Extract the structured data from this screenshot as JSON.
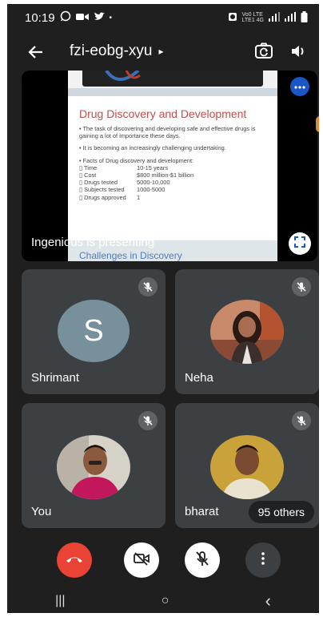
{
  "status_bar": {
    "time": "10:19",
    "network_text": "Vo0 LTE\nLTE1 4G",
    "icons": [
      "whatsapp-icon",
      "video-icon",
      "twitter-icon",
      "dot-icon",
      "alarm-icon",
      "signal-icon",
      "signal-icon",
      "battery-icon"
    ]
  },
  "header": {
    "meeting_code": "fzi-eobg-xyu",
    "caret": "▸"
  },
  "presentation": {
    "slide_title": "Drug Discovery and Development",
    "bullet1": "• The task of discovering and developing safe and effective drugs is gaining a lot of importance these days.",
    "bullet2": "• It is becoming an increasingly challenging undertaking.",
    "facts_heading": "• Facts of Drug discovery and development:",
    "facts": [
      {
        "k": "▯ Time",
        "v": "10-15 years"
      },
      {
        "k": "▯ Cost",
        "v": "$800 million-$1 billion"
      },
      {
        "k": "▯ Drugs tested",
        "v": "5000-10,000"
      },
      {
        "k": "▯ Subjects tested",
        "v": "1000-5000"
      },
      {
        "k": "▯ Drugs approved",
        "v": "1"
      }
    ],
    "next_slide_peek": "Challenges in Discovery",
    "presenting_label": "Ingenious is presenting"
  },
  "participants": {
    "shrimant": {
      "name": "Shrimant",
      "initial": "S"
    },
    "neha": {
      "name": "Neha"
    },
    "you": {
      "name": "You"
    },
    "bharat": {
      "name": "bharat"
    },
    "others_badge": "95 others"
  },
  "colors": {
    "hangup": "#ea4335",
    "tile_bg": "#3c4043",
    "screen_bg": "#1f1f1f",
    "accent_blue": "#1a56c4",
    "avatar_gray": "#78909c"
  },
  "navbar": {
    "recents": "|||",
    "home": "○",
    "back": "‹"
  }
}
